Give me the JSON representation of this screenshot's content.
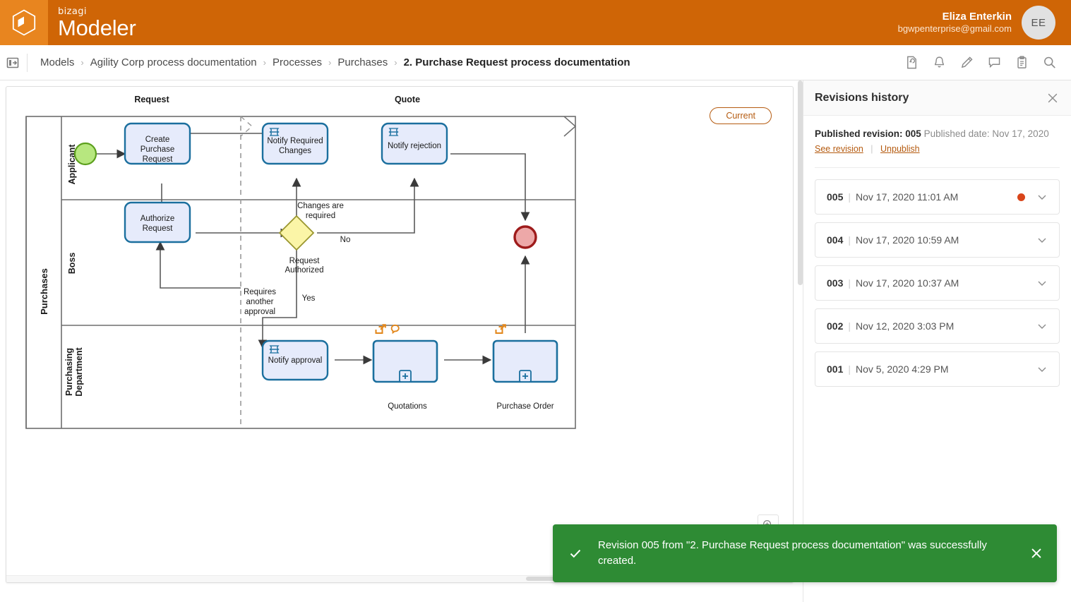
{
  "brand": {
    "product_prefix": "bizagi",
    "product_name": "Modeler",
    "logo_icon": "cube-logo-icon",
    "accent": "#cf6506",
    "accent_light": "#e8851f"
  },
  "user": {
    "name": "Eliza Enterkin",
    "email": "bgwpenterprise@gmail.com",
    "initials": "EE"
  },
  "breadcrumb": {
    "toggle_icon": "panel-collapse-icon",
    "separator": "›",
    "items": [
      {
        "label": "Models",
        "active": false
      },
      {
        "label": "Agility Corp process documentation",
        "active": false
      },
      {
        "label": "Processes",
        "active": false
      },
      {
        "label": "Purchases",
        "active": false
      },
      {
        "label": "2. Purchase Request process documentation",
        "active": true
      }
    ],
    "tools": [
      {
        "icon": "revision-history-icon",
        "label": "Revisions history"
      },
      {
        "icon": "bell-icon",
        "label": "Notifications"
      },
      {
        "icon": "pencil-icon",
        "label": "Edit"
      },
      {
        "icon": "comment-icon",
        "label": "Comments"
      },
      {
        "icon": "clipboard-icon",
        "label": "Tasks"
      },
      {
        "icon": "search-icon",
        "label": "Search"
      }
    ]
  },
  "canvas": {
    "current_badge": "Current",
    "zoom_icon": "zoom-in-icon"
  },
  "diagram": {
    "pool_label": "Purchases",
    "lanes": [
      "Applicant",
      "Boss",
      "Purchasing Department"
    ],
    "milestones": [
      "Request",
      "Quote"
    ],
    "tasks": [
      {
        "id": "create",
        "label": "Create Purchase Request",
        "type": "user"
      },
      {
        "id": "authorize",
        "label": "Authorize Request",
        "type": "user"
      },
      {
        "id": "notify-changes",
        "label": "Notify Required Changes",
        "type": "script"
      },
      {
        "id": "notify-rejection",
        "label": "Notify rejection",
        "type": "script"
      },
      {
        "id": "notify-approval",
        "label": "Notify approval",
        "type": "script"
      },
      {
        "id": "quotations",
        "label": "Quotations",
        "type": "subprocess"
      },
      {
        "id": "purchase-order",
        "label": "Purchase Order",
        "type": "subprocess"
      }
    ],
    "gateway": {
      "label": "Request Authorized"
    },
    "flow_labels": [
      "Changes are required",
      "No",
      "Yes",
      "Requires another approval"
    ],
    "start_event": "start-event",
    "end_event": "end-event",
    "markers": [
      "link-icon",
      "comment-bubble-icon",
      "expand-plus-icon"
    ]
  },
  "side_panel": {
    "title": "Revisions history",
    "close_icon": "close-icon",
    "published_prefix": "Published revision: 005",
    "published_date": "Published date: Nov 17, 2020",
    "see_revision": "See revision",
    "unpublish": "Unpublish",
    "divider": "|",
    "revisions": [
      {
        "num": "005",
        "date": "Nov 17, 2020 11:01 AM",
        "published": true
      },
      {
        "num": "004",
        "date": "Nov 17, 2020 10:59 AM",
        "published": false
      },
      {
        "num": "003",
        "date": "Nov 17, 2020 10:37 AM",
        "published": false
      },
      {
        "num": "002",
        "date": "Nov 12, 2020 3:03 PM",
        "published": false
      },
      {
        "num": "001",
        "date": "Nov 5, 2020 4:29 PM",
        "published": false
      }
    ],
    "published_dot_color": "#d9451a"
  },
  "toast": {
    "message": "Revision 005 from \"2. Purchase Request process documentation\" was successfully created.",
    "icon": "check-icon",
    "close_icon": "close-icon",
    "background": "#2e8b34"
  }
}
